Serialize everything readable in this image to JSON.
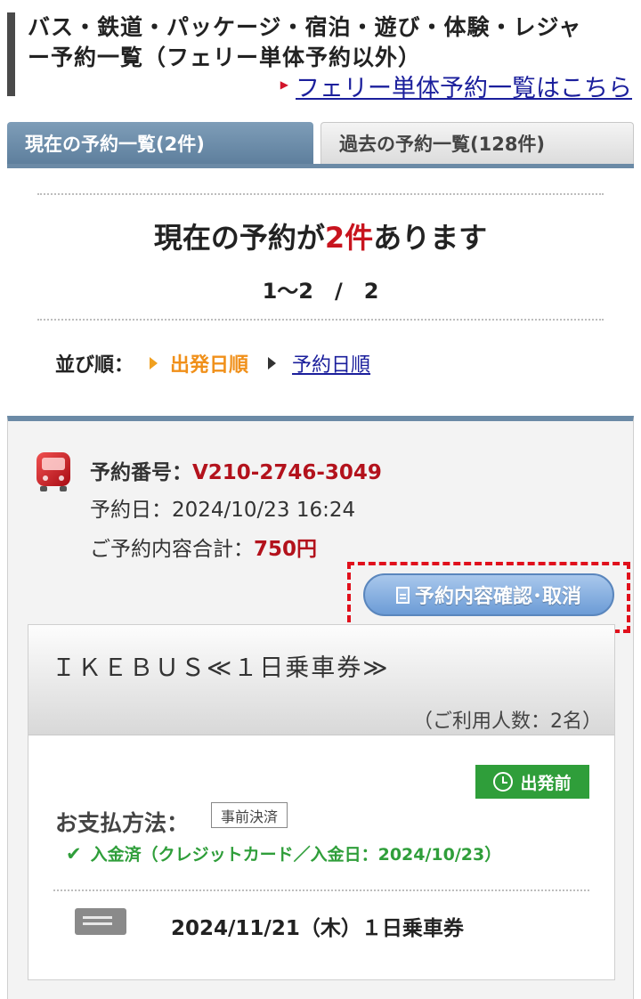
{
  "header": {
    "title_line1": "バス・鉄道・パッケージ・宿泊・遊び・体験・レジャ",
    "title_line2": "ー予約一覧（フェリー単体予約以外）",
    "ferry_link": "フェリー単体予約一覧はこちら"
  },
  "tabs": {
    "current": "現在の予約一覧(2件)",
    "past": "過去の予約一覧(128件)"
  },
  "summary": {
    "prefix": "現在の予約が",
    "count": "2件",
    "suffix": "あります",
    "pager": "1〜2　/　2"
  },
  "sort": {
    "label": "並び順：",
    "active": "出発日順",
    "link": "予約日順"
  },
  "booking": {
    "number_label": "予約番号：",
    "number": "V210-2746-3049",
    "date_label": "予約日：",
    "date": "2024/10/23 16:24",
    "total_label": "ご予約内容合計：",
    "total": "750円",
    "confirm_button": "予約内容確認･取消",
    "ticket": {
      "name": "ＩＫＥＢＵＳ≪１日乗車券≫",
      "people": "（ご利用人数：2名）",
      "status": "出発前",
      "payment_label": "お支払方法：",
      "payment_tag": "事前決済",
      "paid_status": "入金済（クレジットカード／入金日：2024/10/23）",
      "date_line": "2024/11/21（木）１日乗車券"
    }
  },
  "colors": {
    "tab_active": "#6b8aa6",
    "accent_red": "#b3121c",
    "sort_active": "#f0901a",
    "link": "#1b1f9c",
    "status_green": "#2f9e3a",
    "highlight": "#e0101c"
  },
  "icons": {
    "booking": "bus-icon",
    "confirm_button": "document-icon",
    "status": "clock-icon",
    "paid": "check-icon",
    "ticket": "ticket-icon"
  }
}
